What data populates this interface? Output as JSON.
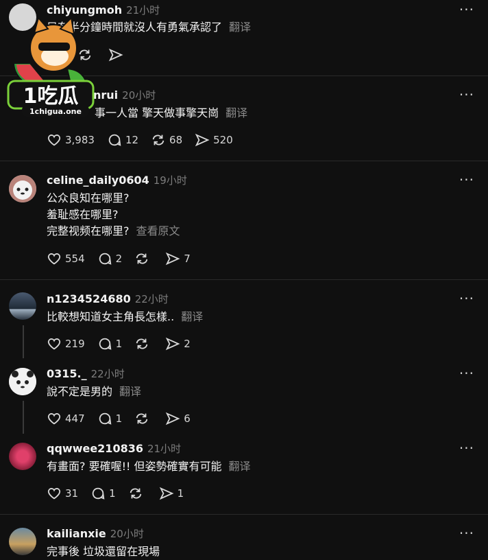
{
  "posts": [
    {
      "user": "chiyungmoh",
      "time": "21小时",
      "text": [
        "只有半分鐘時間就沒人有勇氣承認了"
      ],
      "translate": "翻译",
      "likes": "",
      "replies": "",
      "reposts": "",
      "shares": ""
    },
    {
      "user": "nrui",
      "time": "20小时",
      "text": [
        "事一人當 擎天做事擎天崗"
      ],
      "translate": "翻译",
      "likes": "3,983",
      "replies": "12",
      "reposts": "68",
      "shares": "520"
    },
    {
      "user": "celine_daily0604",
      "time": "19小时",
      "text": [
        "公众良知在哪里?",
        "羞耻感在哪里?",
        "完整视频在哪里?"
      ],
      "translate": "查看原文",
      "likes": "554",
      "replies": "2",
      "reposts": "",
      "shares": "7"
    },
    {
      "user": "n1234524680",
      "time": "22小时",
      "text": [
        "比較想知道女主角長怎樣.."
      ],
      "translate": "翻译",
      "likes": "219",
      "replies": "1",
      "reposts": "",
      "shares": "2"
    },
    {
      "user": "0315._",
      "time": "22小时",
      "text": [
        "說不定是男的"
      ],
      "translate": "翻译",
      "likes": "447",
      "replies": "1",
      "reposts": "",
      "shares": "6"
    },
    {
      "user": "qqwwee210836",
      "time": "21小时",
      "text": [
        "有畫面? 要確喔!! 但姿勢確實有可能"
      ],
      "translate": "翻译",
      "likes": "31",
      "replies": "1",
      "reposts": "",
      "shares": "1"
    },
    {
      "user": "kailianxie",
      "time": "20小时",
      "text": [
        "完事後 垃圾還留在現場"
      ],
      "translate": "",
      "likes": "",
      "replies": "",
      "reposts": "",
      "shares": ""
    }
  ],
  "watermark": {
    "brand": "1吃瓜",
    "url": "1chigua.one"
  },
  "more_glyph": "···"
}
